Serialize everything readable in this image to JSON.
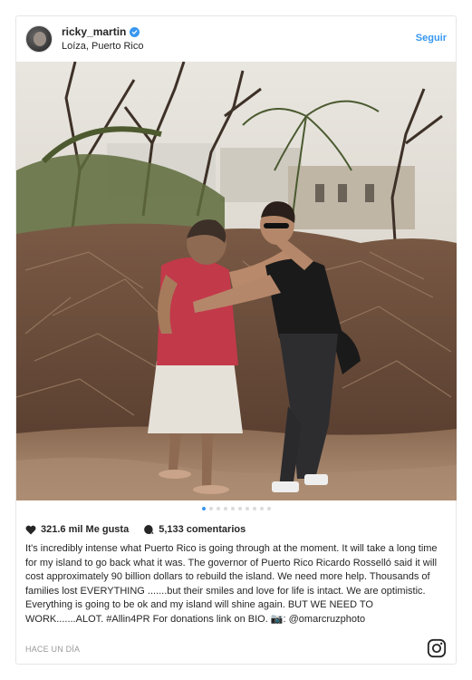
{
  "post": {
    "username": "ricky_martin",
    "location": "Loíza, Puerto Rico",
    "follow_label": "Seguir",
    "verified": true,
    "likes_text": "321.6 mil Me gusta",
    "comments_text": "5,133 comentarios",
    "caption": "It's incredibly intense what Puerto Rico is going through at the moment. It will take a long time for my island to go back what it was. The governor of Puerto Rico Ricardo Rosselló said it will cost approximately 90 billion dollars to rebuild the island. We need more help. Thousands of families lost EVERYTHING .......but their smiles and love for life is intact. We are optimistic. Everything is going to be ok and my island will shine again. BUT WE NEED TO WORK.......ALOT. #Allin4PR For donations link on BIO. 📷: @omarcruzphoto",
    "timestamp": "HACE UN DÍA",
    "carousel": {
      "count": 10,
      "active_index": 0
    }
  },
  "icons": {
    "avatar": "profile-avatar",
    "verified": "verified-badge-icon",
    "likes": "heart-icon",
    "comments": "comment-bubble-icon",
    "logo": "instagram-logo-icon"
  },
  "colors": {
    "accent": "#3897f0",
    "text": "#262626",
    "muted": "#999999",
    "border": "#e6e6e6"
  }
}
